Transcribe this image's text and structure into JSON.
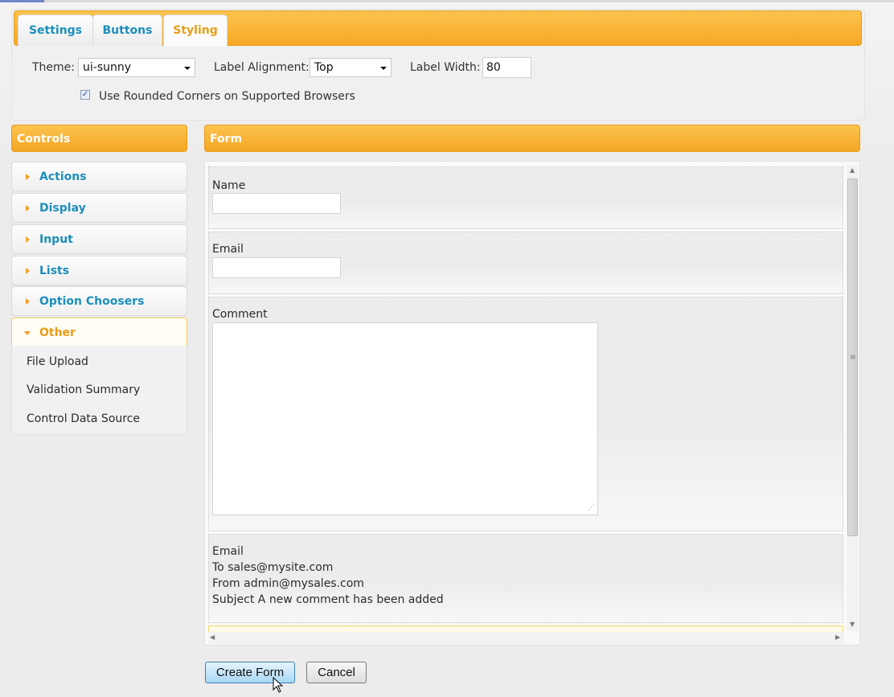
{
  "tabs": [
    {
      "label": "Settings",
      "active": false
    },
    {
      "label": "Buttons",
      "active": false
    },
    {
      "label": "Styling",
      "active": true
    }
  ],
  "styling": {
    "theme_label": "Theme:",
    "theme_value": "ui-sunny",
    "label_alignment_label": "Label Alignment:",
    "label_alignment_value": "Top",
    "label_width_label": "Label Width:",
    "label_width_value": "80",
    "rounded_corners_label": "Use Rounded Corners on Supported Browsers",
    "rounded_corners_checked": true
  },
  "controls": {
    "header": "Controls",
    "items": [
      {
        "label": "Actions"
      },
      {
        "label": "Display"
      },
      {
        "label": "Input"
      },
      {
        "label": "Lists"
      },
      {
        "label": "Option Choosers"
      },
      {
        "label": "Other",
        "expanded": true
      }
    ],
    "other_items": [
      "File Upload",
      "Validation Summary",
      "Control Data Source"
    ]
  },
  "form": {
    "header": "Form",
    "name_label": "Name",
    "email_label": "Email",
    "comment_label": "Comment",
    "email_block": {
      "title": "Email",
      "to": "To sales@mysite.com",
      "from": "From admin@mysales.com",
      "subject": "Subject A new comment has been added"
    }
  },
  "buttons": {
    "create": "Create Form",
    "cancel": "Cancel"
  },
  "colors": {
    "accent_orange": "#f7a823",
    "link_blue": "#1c8fba",
    "active_orange_text": "#e99c17"
  }
}
